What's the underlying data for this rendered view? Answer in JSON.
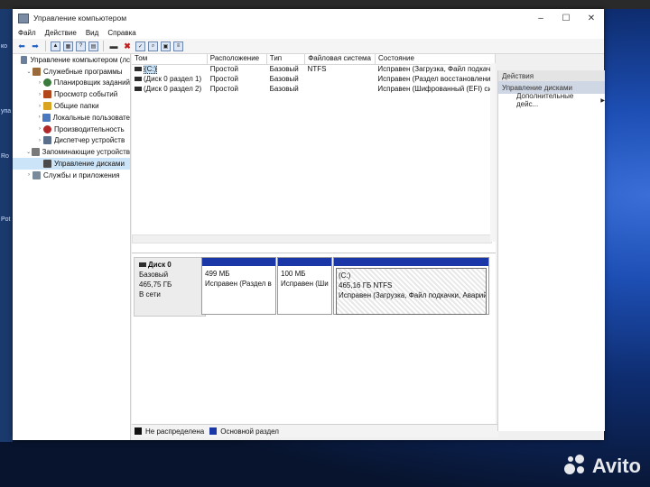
{
  "window": {
    "title": "Управление компьютером"
  },
  "menu": [
    "Файл",
    "Действие",
    "Вид",
    "Справка"
  ],
  "tree": [
    {
      "label": "Управление компьютером (лс",
      "level": 0,
      "icon": "computer-icon"
    },
    {
      "label": "Служебные программы",
      "level": 1,
      "icon": "tools-icon"
    },
    {
      "label": "Планировщик заданий",
      "level": 2,
      "icon": "clock-icon"
    },
    {
      "label": "Просмотр событий",
      "level": 2,
      "icon": "event-log-icon"
    },
    {
      "label": "Общие папки",
      "level": 2,
      "icon": "folder-icon"
    },
    {
      "label": "Локальные пользовате",
      "level": 2,
      "icon": "users-icon"
    },
    {
      "label": "Производительность",
      "level": 2,
      "icon": "performance-icon"
    },
    {
      "label": "Диспетчер устройств",
      "level": 2,
      "icon": "device-manager-icon"
    },
    {
      "label": "Запоминающие устройств",
      "level": 1,
      "icon": "storage-icon"
    },
    {
      "label": "Управление дисками",
      "level": 2,
      "icon": "disk-icon",
      "selected": true
    },
    {
      "label": "Службы и приложения",
      "level": 1,
      "icon": "services-icon"
    }
  ],
  "volumes": {
    "headers": [
      "Том",
      "Расположение",
      "Тип",
      "Файловая система",
      "Состояние"
    ],
    "rows": [
      [
        "(C:)",
        "Простой",
        "Базовый",
        "NTFS",
        "Исправен (Загрузка, Файл подкачки,"
      ],
      [
        "(Диск 0 раздел 1)",
        "Простой",
        "Базовый",
        "",
        "Исправен (Раздел восстановления)"
      ],
      [
        "(Диск 0 раздел 2)",
        "Простой",
        "Базовый",
        "",
        "Исправен (Шифрованный (EFI) систе"
      ]
    ]
  },
  "disk": {
    "name": "Диск 0",
    "type": "Базовый",
    "size": "465,75 ГБ",
    "status": "В сети",
    "partitions": [
      {
        "title": "",
        "size": "499 МБ",
        "status": "Исправен (Раздел в"
      },
      {
        "title": "",
        "size": "100 МБ",
        "status": "Исправен (Ши"
      },
      {
        "title": "(C:)",
        "size": "465,16 ГБ NTFS",
        "status": "Исправен (Загрузка, Файл подкачки, Аварийн"
      }
    ]
  },
  "legend": [
    {
      "label": "Не распределена",
      "color": "#111111"
    },
    {
      "label": "Основной раздел",
      "color": "#1a37a8"
    }
  ],
  "actions": {
    "header": "Действия",
    "section": "Управление дисками",
    "item": "Дополнительные дейс..."
  },
  "desktop_text": [
    "ко",
    "упа",
    "Ro",
    "Pot"
  ],
  "watermark": "Avito",
  "colors": {
    "partition_bar": "#1a37a8",
    "selection": "#cce4f7",
    "desktop_blue": "#1d4fb5"
  }
}
